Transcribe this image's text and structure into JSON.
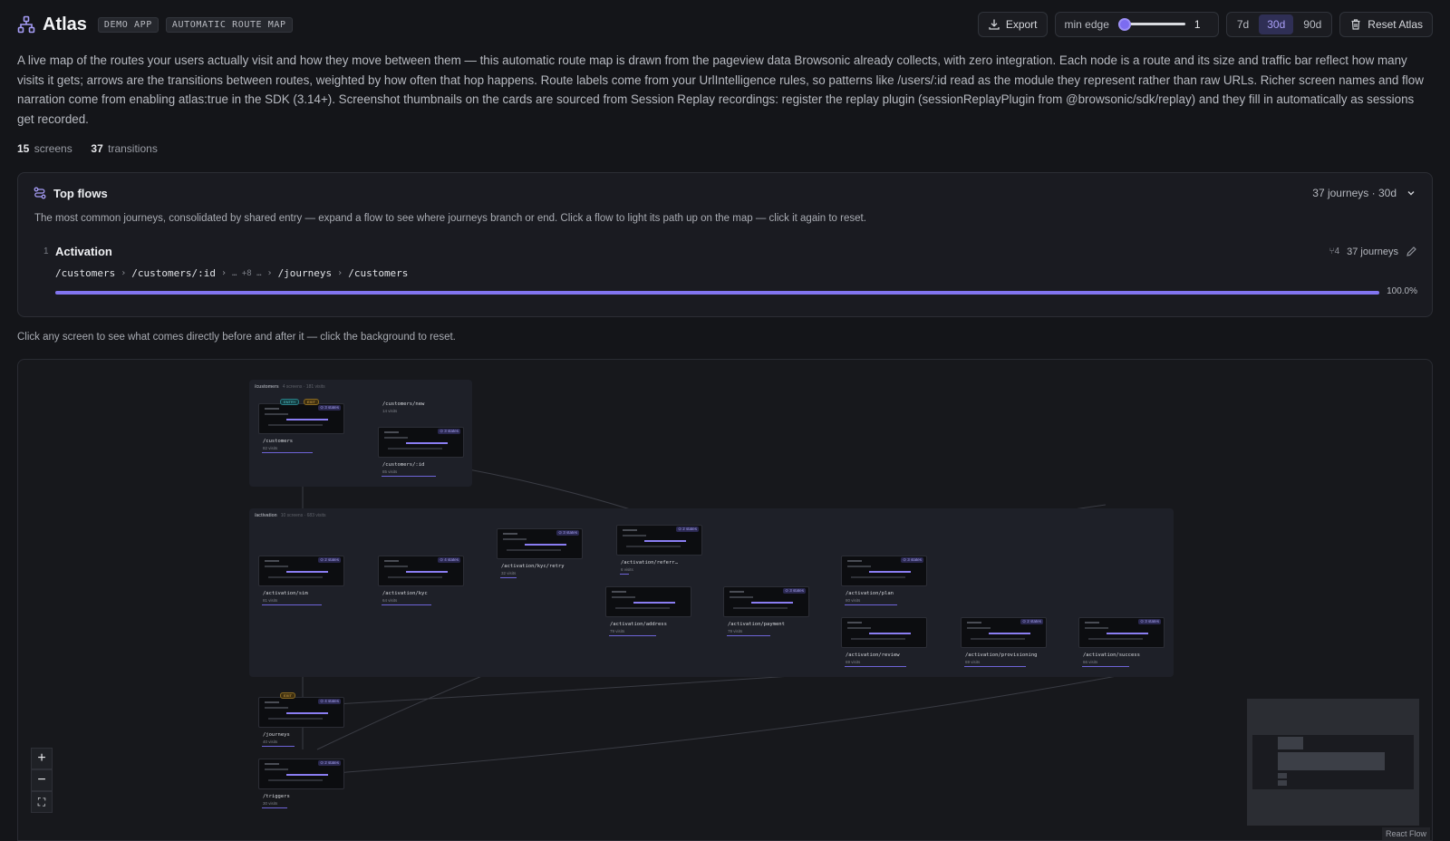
{
  "header": {
    "title": "Atlas",
    "tags": [
      "DEMO APP",
      "AUTOMATIC ROUTE MAP"
    ],
    "export_label": "Export",
    "min_edge_label": "min edge",
    "min_edge_value": "1",
    "min_edge_slider_fraction": 0,
    "ranges": [
      "7d",
      "30d",
      "90d"
    ],
    "active_range": "30d",
    "reset_label": "Reset Atlas"
  },
  "description": "A live map of the routes your users actually visit and how they move between them — this automatic route map is drawn from the pageview data Browsonic already collects, with zero integration. Each node is a route and its size and traffic bar reflect how many visits it gets; arrows are the transitions between routes, weighted by how often that hop happens. Route labels come from your UrlIntelligence rules, so patterns like /users/:id read as the module they represent rather than raw URLs. Richer screen names and flow narration come from enabling atlas:true in the SDK (3.14+). Screenshot thumbnails on the cards are sourced from Session Replay recordings: register the replay plugin (sessionReplayPlugin from @browsonic/sdk/replay) and they fill in automatically as sessions get recorded.",
  "stats": {
    "screens": "15",
    "screens_label": "screens",
    "transitions": "37",
    "transitions_label": "transitions"
  },
  "top_flows": {
    "title": "Top flows",
    "meta": "37 journeys · 30d",
    "subtitle": "The most common journeys, consolidated by shared entry — expand a flow to see where journeys branch or end. Click a flow to light its path up on the map — click it again to reset.",
    "flows": [
      {
        "rank": "1",
        "name": "Activation",
        "branches": "⑂4",
        "journeys": "37 journeys",
        "path": [
          "/customers",
          "/customers/:id",
          "… +8 …",
          "/journeys",
          "/customers"
        ],
        "percent": "100.0%",
        "share": 1.0
      }
    ]
  },
  "map_hint": "Click any screen to see what comes directly before and after it — click the background to reset.",
  "map": {
    "groups": [
      {
        "label": "/customers",
        "meta": "4 screens · 181 visits"
      },
      {
        "label": "/activation",
        "meta": "10 screens · 683 visits"
      }
    ],
    "nodes": [
      {
        "route": "/customers",
        "visits": "82 visits",
        "states": "⊙ 3 states",
        "badges": [
          "ENTRY",
          "EXIT"
        ]
      },
      {
        "route": "/customers/new",
        "visits": "14 visits",
        "states": "",
        "badges": []
      },
      {
        "route": "/customers/:id",
        "visits": "85 visits",
        "states": "⊙ 3 states",
        "badges": []
      },
      {
        "route": "/activation/sim",
        "visits": "81 visits",
        "states": "⊙ 2 states",
        "badges": []
      },
      {
        "route": "/activation/kyc",
        "visits": "64 visits",
        "states": "⊙ 4 states",
        "badges": []
      },
      {
        "route": "/activation/kyc/retry",
        "visits": "32 visits",
        "states": "⊙ 3 states",
        "badges": []
      },
      {
        "route": "/activation/referr…",
        "visits": "6 visits",
        "states": "⊙ 2 states",
        "badges": []
      },
      {
        "route": "/activation/address",
        "visits": "79 visits",
        "states": "",
        "badges": []
      },
      {
        "route": "/activation/payment",
        "visits": "79 visits",
        "states": "⊙ 3 states",
        "badges": []
      },
      {
        "route": "/activation/plan",
        "visits": "80 visits",
        "states": "⊙ 3 states",
        "badges": []
      },
      {
        "route": "/activation/review",
        "visits": "69 visits",
        "states": "",
        "badges": []
      },
      {
        "route": "/activation/provisioning",
        "visits": "69 visits",
        "states": "⊙ 2 states",
        "badges": []
      },
      {
        "route": "/activation/success",
        "visits": "66 visits",
        "states": "⊙ 3 states",
        "badges": []
      },
      {
        "route": "/journeys",
        "visits": "40 visits",
        "states": "⊙ 4 states",
        "badges": [
          "EXIT"
        ]
      },
      {
        "route": "/triggers",
        "visits": "30 visits",
        "states": "⊙ 2 states",
        "badges": []
      }
    ],
    "zoom_in": "+",
    "zoom_out": "−",
    "fit": "⛶",
    "attribution": "React Flow"
  },
  "colors": {
    "accent": "#7c6cf0",
    "entry": "#5fd3d8",
    "exit": "#e8b24c",
    "background": "#141519"
  }
}
